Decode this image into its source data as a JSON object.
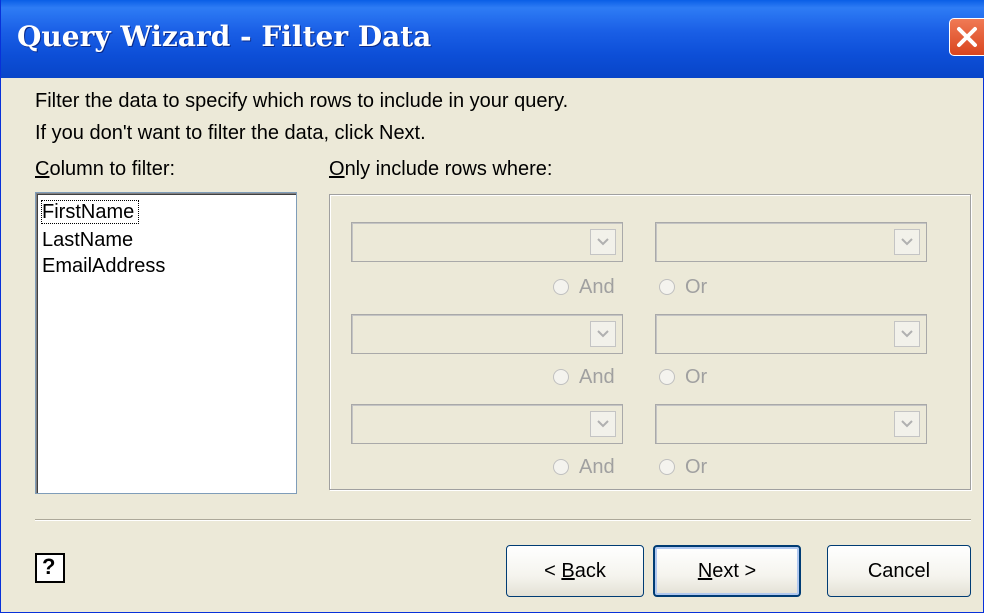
{
  "window": {
    "title": "Query Wizard - Filter Data"
  },
  "instructions": {
    "line1": "Filter the data to specify which rows to include in your query.",
    "line2": "If you don't want to filter the data, click Next."
  },
  "column_filter": {
    "label": "Column to filter:",
    "items": [
      "FirstName",
      "LastName",
      "EmailAddress"
    ],
    "selected": "FirstName"
  },
  "conditions": {
    "label": "Only include rows where:",
    "rows": [
      {
        "operator": "",
        "value": "",
        "and_label": "And",
        "or_label": "Or"
      },
      {
        "operator": "",
        "value": "",
        "and_label": "And",
        "or_label": "Or"
      },
      {
        "operator": "",
        "value": "",
        "and_label": "And",
        "or_label": "Or"
      }
    ]
  },
  "buttons": {
    "back_prefix": "< ",
    "back_accel": "B",
    "back_rest": "ack",
    "next_accel": "N",
    "next_rest": "ext >",
    "cancel": "Cancel"
  },
  "icons": {
    "close": "close-icon",
    "help": "help-icon",
    "dropdown": "chevron-down-icon"
  }
}
